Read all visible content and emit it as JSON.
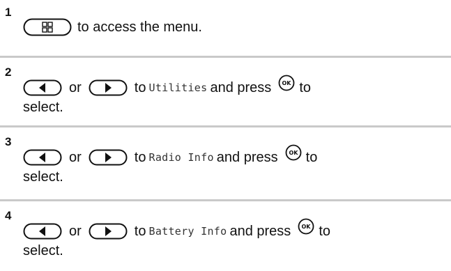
{
  "steps": [
    {
      "number": "1",
      "after_menu": "to access the menu."
    },
    {
      "number": "2",
      "or": "or",
      "to": "to",
      "item": "Utilities",
      "press": "and press",
      "to_end": "to",
      "select": "select."
    },
    {
      "number": "3",
      "or": "or",
      "to": "to",
      "item": "Radio Info",
      "press": "and press",
      "to_end": "to",
      "select": "select."
    },
    {
      "number": "4",
      "or": "or",
      "to": "to",
      "item": "Battery Info",
      "press": "and press",
      "to_end": "to",
      "select": "select."
    }
  ],
  "icons": {
    "menu": "menu-button-icon",
    "left": "left-arrow-button-icon",
    "right": "right-arrow-button-icon",
    "ok": "ok-button-icon"
  },
  "ok_label": "OK",
  "colors": {
    "separator": "#c9c9c9"
  }
}
